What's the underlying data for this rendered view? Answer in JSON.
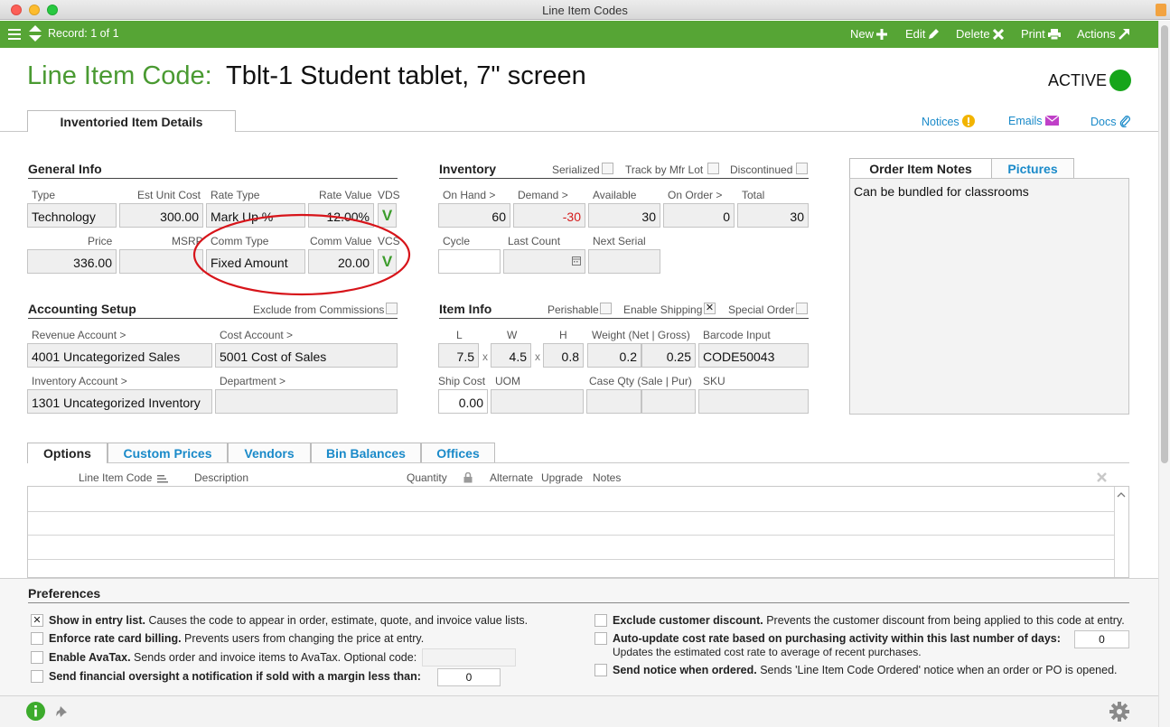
{
  "window": {
    "title": "Line Item Codes"
  },
  "toolbar": {
    "record": "Record: 1 of 1",
    "new": "New",
    "edit": "Edit",
    "delete": "Delete",
    "print": "Print",
    "actions": "Actions"
  },
  "header": {
    "label": "Line Item Code:",
    "title": "Tblt-1 Student tablet, 7\" screen",
    "status": "ACTIVE",
    "status_color": "#16a51a"
  },
  "tabs": {
    "main": "Inventoried Item Details"
  },
  "links": {
    "notices": "Notices",
    "emails": "Emails",
    "docs": "Docs"
  },
  "general": {
    "title": "General Info",
    "type_label": "Type",
    "type": "Technology",
    "est_cost_label": "Est Unit Cost",
    "est_cost": "300.00",
    "rate_type_label": "Rate Type",
    "rate_type": "Mark Up %",
    "rate_value_label": "Rate Value",
    "rate_value": "12.00%",
    "vds_label": "VDS",
    "price_label": "Price",
    "price": "336.00",
    "msrp_label": "MSRP",
    "msrp": "",
    "comm_type_label": "Comm Type",
    "comm_type": "Fixed Amount",
    "comm_value_label": "Comm Value",
    "comm_value": "20.00",
    "vcs_label": "VCS",
    "v_mark": "V"
  },
  "inventory": {
    "title": "Inventory",
    "serialized": "Serialized",
    "track": "Track by Mfr Lot",
    "discontinued": "Discontinued",
    "on_hand_label": "On Hand >",
    "on_hand": "60",
    "demand_label": "Demand >",
    "demand": "-30",
    "available_label": "Available",
    "available": "30",
    "on_order_label": "On Order >",
    "on_order": "0",
    "total_label": "Total",
    "total": "30",
    "cycle_label": "Cycle",
    "last_count_label": "Last Count",
    "next_serial_label": "Next Serial"
  },
  "accounting": {
    "title": "Accounting Setup",
    "exclude": "Exclude from Commissions",
    "revenue_label": "Revenue Account >",
    "revenue": "4001 Uncategorized Sales",
    "cost_label": "Cost Account >",
    "cost": "5001 Cost of Sales",
    "inventory_label": "Inventory Account >",
    "inventory": "1301 Uncategorized Inventory",
    "department_label": "Department >"
  },
  "item_info": {
    "title": "Item Info",
    "perishable": "Perishable",
    "shipping": "Enable Shipping",
    "special": "Special Order",
    "l_label": "L",
    "l": "7.5",
    "w_label": "W",
    "w": "4.5",
    "h_label": "H",
    "h": "0.8",
    "x": "x",
    "weight_label": "Weight (Net | Gross)",
    "weight_net": "0.2",
    "weight_gross": "0.25",
    "barcode_label": "Barcode Input",
    "barcode": "CODE50043",
    "ship_cost_label": "Ship Cost",
    "ship_cost": "0.00",
    "uom_label": "UOM",
    "case_qty_label": "Case Qty (Sale | Pur)",
    "sku_label": "SKU"
  },
  "notes_panel": {
    "tab_notes": "Order Item Notes",
    "tab_pictures": "Pictures",
    "text": "Can be bundled for classrooms"
  },
  "lower_tabs": [
    "Options",
    "Custom Prices",
    "Vendors",
    "Bin Balances",
    "Offices"
  ],
  "table": {
    "columns": [
      "Line Item Code",
      "Description",
      "Quantity",
      "Alternate",
      "Upgrade",
      "Notes"
    ]
  },
  "preferences": {
    "title": "Preferences",
    "show_b": "Show in entry list.",
    "show_t": " Causes the code to appear in order, estimate, quote, and invoice value lists.",
    "enforce_b": "Enforce rate card billing.",
    "enforce_t": " Prevents users from changing the price at entry.",
    "avatax_b": "Enable AvaTax.",
    "avatax_t": " Sends order and invoice items to AvaTax. Optional code:",
    "oversight_b": "Send financial oversight a notification if sold with a margin less than:",
    "oversight_value": "0",
    "exclude_b": "Exclude customer discount.",
    "exclude_t": " Prevents the customer discount from being applied to this code at entry.",
    "auto_b": "Auto-update cost rate based on purchasing activity within this last number of days:",
    "auto_value": "0",
    "auto_t2": "Updates the estimated cost rate to average of recent purchases.",
    "notice_b": "Send notice when ordered.",
    "notice_t": " Sends 'Line Item Code Ordered' notice when an order or PO is opened."
  },
  "colors": {
    "accent_green": "#56a535",
    "link_blue": "#1a8ac9",
    "annotation_red": "#d7141a"
  }
}
